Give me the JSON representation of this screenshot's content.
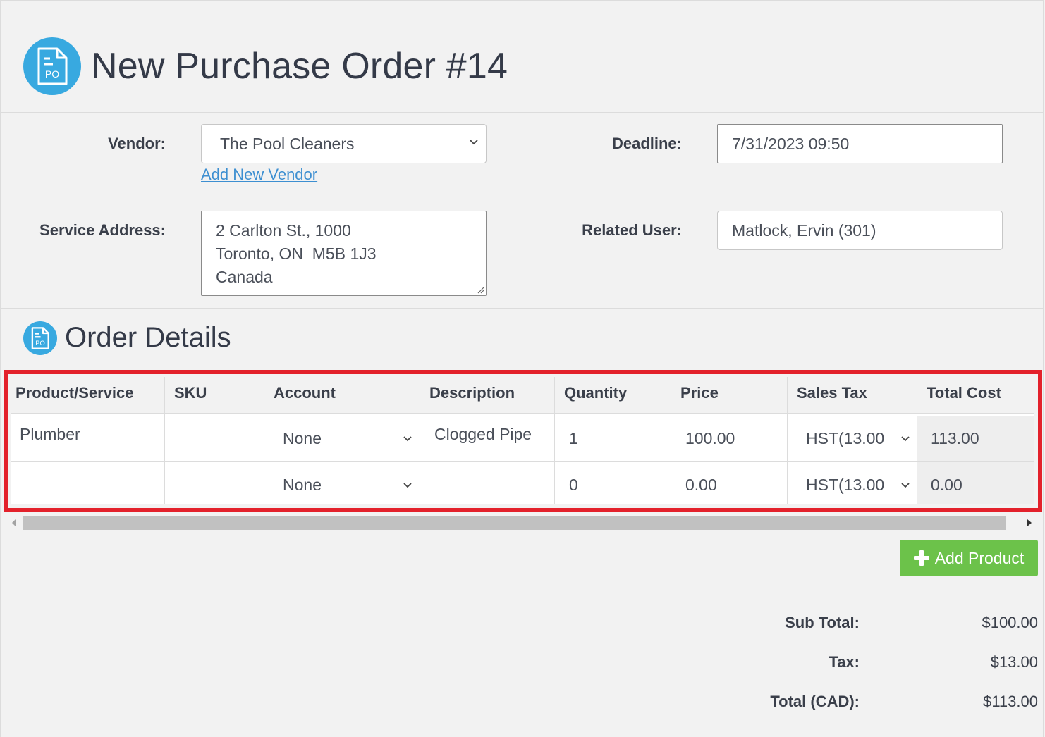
{
  "page": {
    "title": "New Purchase Order #14",
    "icon": "purchase-order-icon",
    "icon_badge": "PO"
  },
  "form": {
    "vendor_label": "Vendor:",
    "vendor_value": "The Pool Cleaners",
    "add_vendor_link": "Add New Vendor",
    "deadline_label": "Deadline:",
    "deadline_value": "7/31/2023 09:50",
    "service_address_label": "Service Address:",
    "service_address_lines": [
      "2 Carlton St., 1000",
      "Toronto, ON  M5B 1J3",
      "Canada"
    ],
    "related_user_label": "Related User:",
    "related_user_value": "Matlock, Ervin (301)"
  },
  "order_details": {
    "title": "Order Details",
    "columns": [
      "Product/Service",
      "SKU",
      "Account",
      "Description",
      "Quantity",
      "Price",
      "Sales Tax",
      "Total Cost"
    ],
    "rows": [
      {
        "product": "Plumber",
        "sku": "",
        "account": "None",
        "description": "Clogged Pipe",
        "quantity": "1",
        "price": "100.00",
        "sales_tax": "HST(13.00",
        "total_cost": "113.00"
      },
      {
        "product": "",
        "sku": "",
        "account": "None",
        "description": "",
        "quantity": "0",
        "price": "0.00",
        "sales_tax": "HST(13.00",
        "total_cost": "0.00"
      }
    ],
    "add_product_label": "Add Product"
  },
  "summary": {
    "subtotal_label": "Sub Total:",
    "subtotal_value": "$100.00",
    "tax_label": "Tax:",
    "tax_value": "$13.00",
    "total_label": "Total (CAD):",
    "total_value": "$113.00"
  },
  "colors": {
    "accent": "#38a9e0",
    "highlight": "#e3212b",
    "add_button": "#6cc24a",
    "link": "#3d8fd1"
  }
}
